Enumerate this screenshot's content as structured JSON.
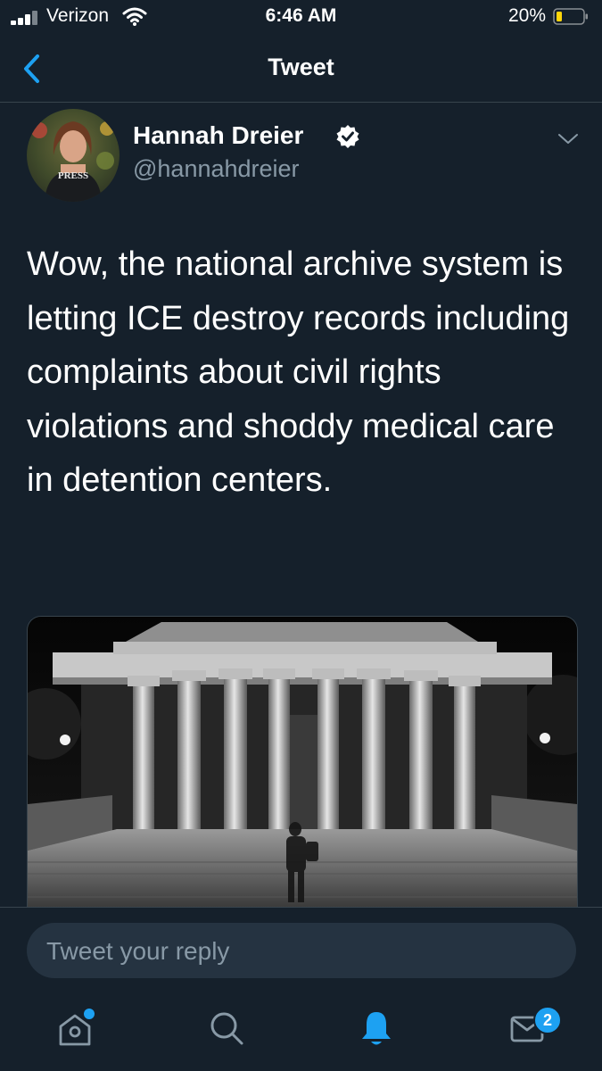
{
  "status": {
    "carrier": "Verizon",
    "time": "6:46 AM",
    "battery": "20%",
    "signal_icon": "signal-bars-icon",
    "wifi_icon": "wifi-icon",
    "battery_icon": "battery-low-icon"
  },
  "nav": {
    "title": "Tweet",
    "back_icon": "chevron-left-icon"
  },
  "tweet": {
    "author_name": "Hannah Dreier",
    "handle": "@hannahdreier",
    "verified": true,
    "avatar_vest_text": "PRESS",
    "text": "Wow, the national archive system is letting ICE destroy records including complaints about civil rights violations and shoddy medical care in detention centers.",
    "media_description_icon": "photo-icon"
  },
  "reply": {
    "placeholder": "Tweet your reply"
  },
  "tabs": [
    {
      "name": "home",
      "icon": "home-icon",
      "has_dot": true
    },
    {
      "name": "search",
      "icon": "search-icon"
    },
    {
      "name": "notifications",
      "icon": "bell-icon",
      "active": true
    },
    {
      "name": "messages",
      "icon": "mail-icon",
      "badge": "2"
    }
  ],
  "colors": {
    "background": "#15202b",
    "accent": "#1da1f2",
    "secondary_text": "#8899a6",
    "battery_warning": "#ffd60a"
  }
}
